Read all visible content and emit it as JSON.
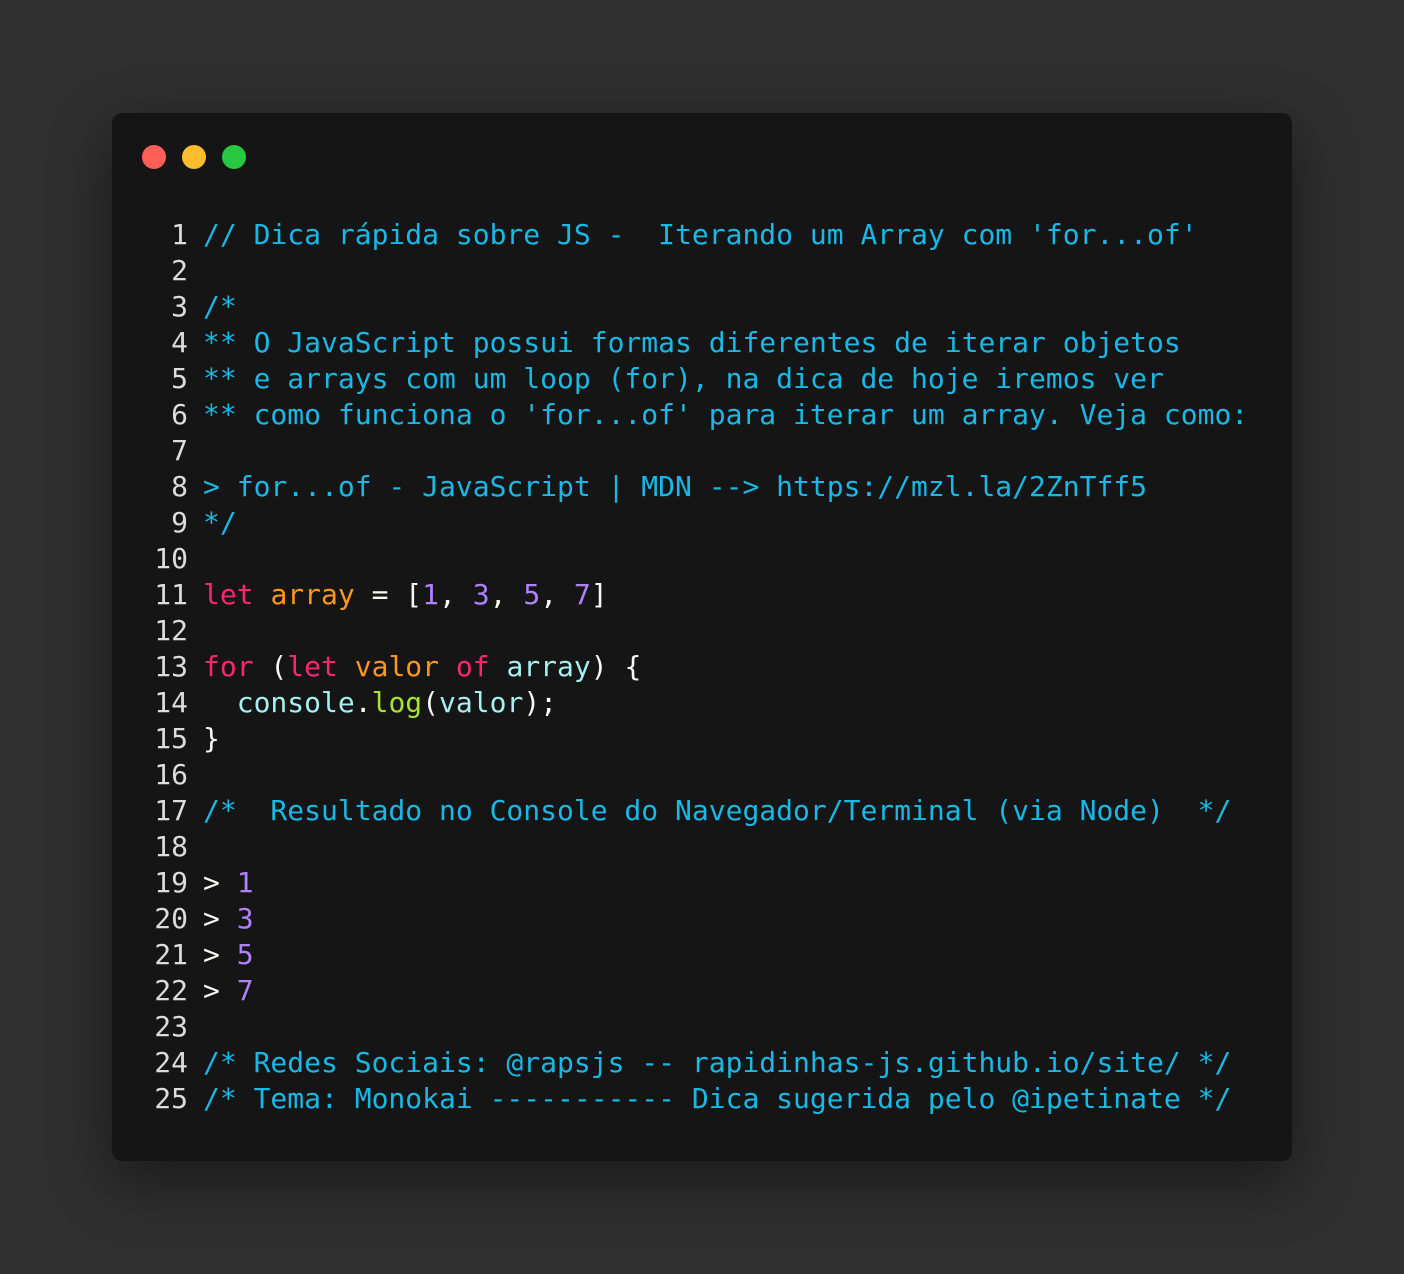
{
  "window": {
    "controls": [
      {
        "name": "close",
        "color": "#ff5f56"
      },
      {
        "name": "minimize",
        "color": "#ffbd2e"
      },
      {
        "name": "maximize",
        "color": "#27c93f"
      }
    ]
  },
  "theme": {
    "background": "#151515",
    "page_background": "#2f2f2f",
    "comment": "#1ab8e6",
    "keyword": "#f92672",
    "variable": "#fd971f",
    "number": "#ae81ff",
    "plain": "#f8f8f2",
    "function": "#a6e22e"
  },
  "code": {
    "lines": [
      {
        "n": "1",
        "tokens": [
          {
            "t": "comment",
            "v": "// Dica rápida sobre JS -  Iterando um Array com 'for...of'"
          }
        ]
      },
      {
        "n": "2",
        "tokens": []
      },
      {
        "n": "3",
        "tokens": [
          {
            "t": "comment",
            "v": "/*"
          }
        ]
      },
      {
        "n": "4",
        "tokens": [
          {
            "t": "comment",
            "v": "** O JavaScript possui formas diferentes de iterar objetos"
          }
        ]
      },
      {
        "n": "5",
        "tokens": [
          {
            "t": "comment",
            "v": "** e arrays com um loop (for), na dica de hoje iremos ver"
          }
        ]
      },
      {
        "n": "6",
        "tokens": [
          {
            "t": "comment",
            "v": "** como funciona o 'for...of' para iterar um array. Veja como:"
          }
        ]
      },
      {
        "n": "7",
        "tokens": []
      },
      {
        "n": "8",
        "tokens": [
          {
            "t": "comment",
            "v": "> for...of - JavaScript | MDN --> https://mzl.la/2ZnTff5"
          }
        ]
      },
      {
        "n": "9",
        "tokens": [
          {
            "t": "comment",
            "v": "*/"
          }
        ]
      },
      {
        "n": "10",
        "tokens": []
      },
      {
        "n": "11",
        "tokens": [
          {
            "t": "keyword",
            "v": "let"
          },
          {
            "t": "plain",
            "v": " "
          },
          {
            "t": "var",
            "v": "array"
          },
          {
            "t": "plain",
            "v": " = ["
          },
          {
            "t": "number",
            "v": "1"
          },
          {
            "t": "plain",
            "v": ", "
          },
          {
            "t": "number",
            "v": "3"
          },
          {
            "t": "plain",
            "v": ", "
          },
          {
            "t": "number",
            "v": "5"
          },
          {
            "t": "plain",
            "v": ", "
          },
          {
            "t": "number",
            "v": "7"
          },
          {
            "t": "plain",
            "v": "]"
          }
        ]
      },
      {
        "n": "12",
        "tokens": []
      },
      {
        "n": "13",
        "tokens": [
          {
            "t": "keyword",
            "v": "for"
          },
          {
            "t": "plain",
            "v": " ("
          },
          {
            "t": "keyword",
            "v": "let"
          },
          {
            "t": "plain",
            "v": " "
          },
          {
            "t": "var",
            "v": "valor"
          },
          {
            "t": "plain",
            "v": " "
          },
          {
            "t": "keyword",
            "v": "of"
          },
          {
            "t": "plain",
            "v": " "
          },
          {
            "t": "ident",
            "v": "array"
          },
          {
            "t": "plain",
            "v": ") {"
          }
        ]
      },
      {
        "n": "14",
        "tokens": [
          {
            "t": "plain",
            "v": "  "
          },
          {
            "t": "ident",
            "v": "console"
          },
          {
            "t": "plain",
            "v": "."
          },
          {
            "t": "func",
            "v": "log"
          },
          {
            "t": "plain",
            "v": "("
          },
          {
            "t": "ident",
            "v": "valor"
          },
          {
            "t": "plain",
            "v": ");"
          }
        ]
      },
      {
        "n": "15",
        "tokens": [
          {
            "t": "plain",
            "v": "}"
          }
        ]
      },
      {
        "n": "16",
        "tokens": []
      },
      {
        "n": "17",
        "tokens": [
          {
            "t": "comment",
            "v": "/*  Resultado no Console do Navegador/Terminal (via Node)  */"
          }
        ]
      },
      {
        "n": "18",
        "tokens": []
      },
      {
        "n": "19",
        "tokens": [
          {
            "t": "plain",
            "v": "> "
          },
          {
            "t": "number",
            "v": "1"
          }
        ]
      },
      {
        "n": "20",
        "tokens": [
          {
            "t": "plain",
            "v": "> "
          },
          {
            "t": "number",
            "v": "3"
          }
        ]
      },
      {
        "n": "21",
        "tokens": [
          {
            "t": "plain",
            "v": "> "
          },
          {
            "t": "number",
            "v": "5"
          }
        ]
      },
      {
        "n": "22",
        "tokens": [
          {
            "t": "plain",
            "v": "> "
          },
          {
            "t": "number",
            "v": "7"
          }
        ]
      },
      {
        "n": "23",
        "tokens": []
      },
      {
        "n": "24",
        "tokens": [
          {
            "t": "comment",
            "v": "/* Redes Sociais: @rapsjs -- rapidinhas-js.github.io/site/ */"
          }
        ]
      },
      {
        "n": "25",
        "tokens": [
          {
            "t": "comment",
            "v": "/* Tema: Monokai ----------- Dica sugerida pelo @ipetinate */"
          }
        ]
      }
    ]
  }
}
